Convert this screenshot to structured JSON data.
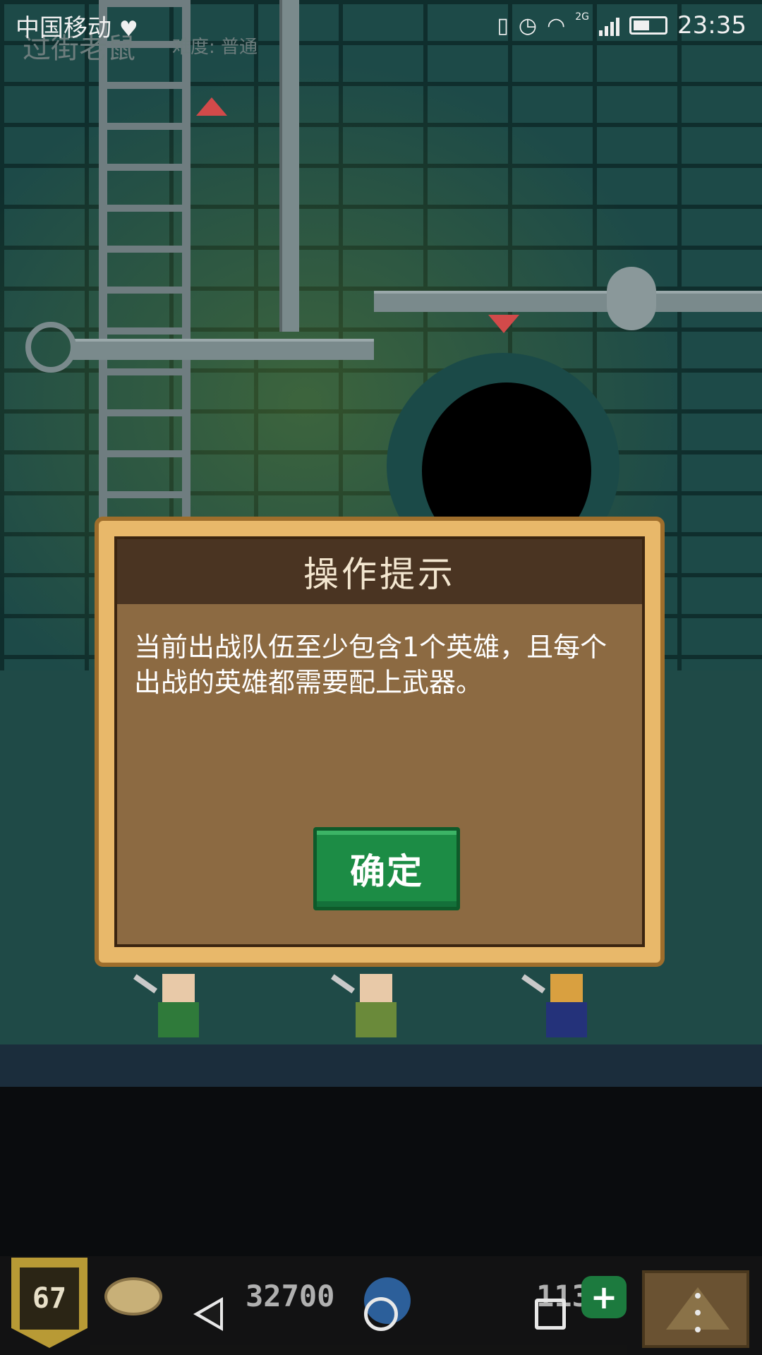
{
  "status_bar": {
    "carrier": "中国移动",
    "network_type": "2G",
    "time": "23:35",
    "icons": [
      "heart-icon",
      "vibrate-icon",
      "alarm-icon",
      "wifi-icon",
      "signal-icon",
      "battery-icon"
    ]
  },
  "game": {
    "title": "过街老鼠",
    "difficulty_label": "难度: 普通"
  },
  "dialog": {
    "title": "操作提示",
    "message": "当前出战队伍至少包含1个英雄，且每个出战的英雄都需要配上武器。",
    "confirm_label": "确定"
  },
  "hud": {
    "level": "67",
    "gold": "32700",
    "gems": "113",
    "plus_label": "+"
  },
  "colors": {
    "dialog_border": "#e8b86a",
    "dialog_body": "#8c6a42",
    "dialog_header": "#4a3422",
    "confirm_button": "#1c8c45",
    "wall": "#1d4a48"
  }
}
